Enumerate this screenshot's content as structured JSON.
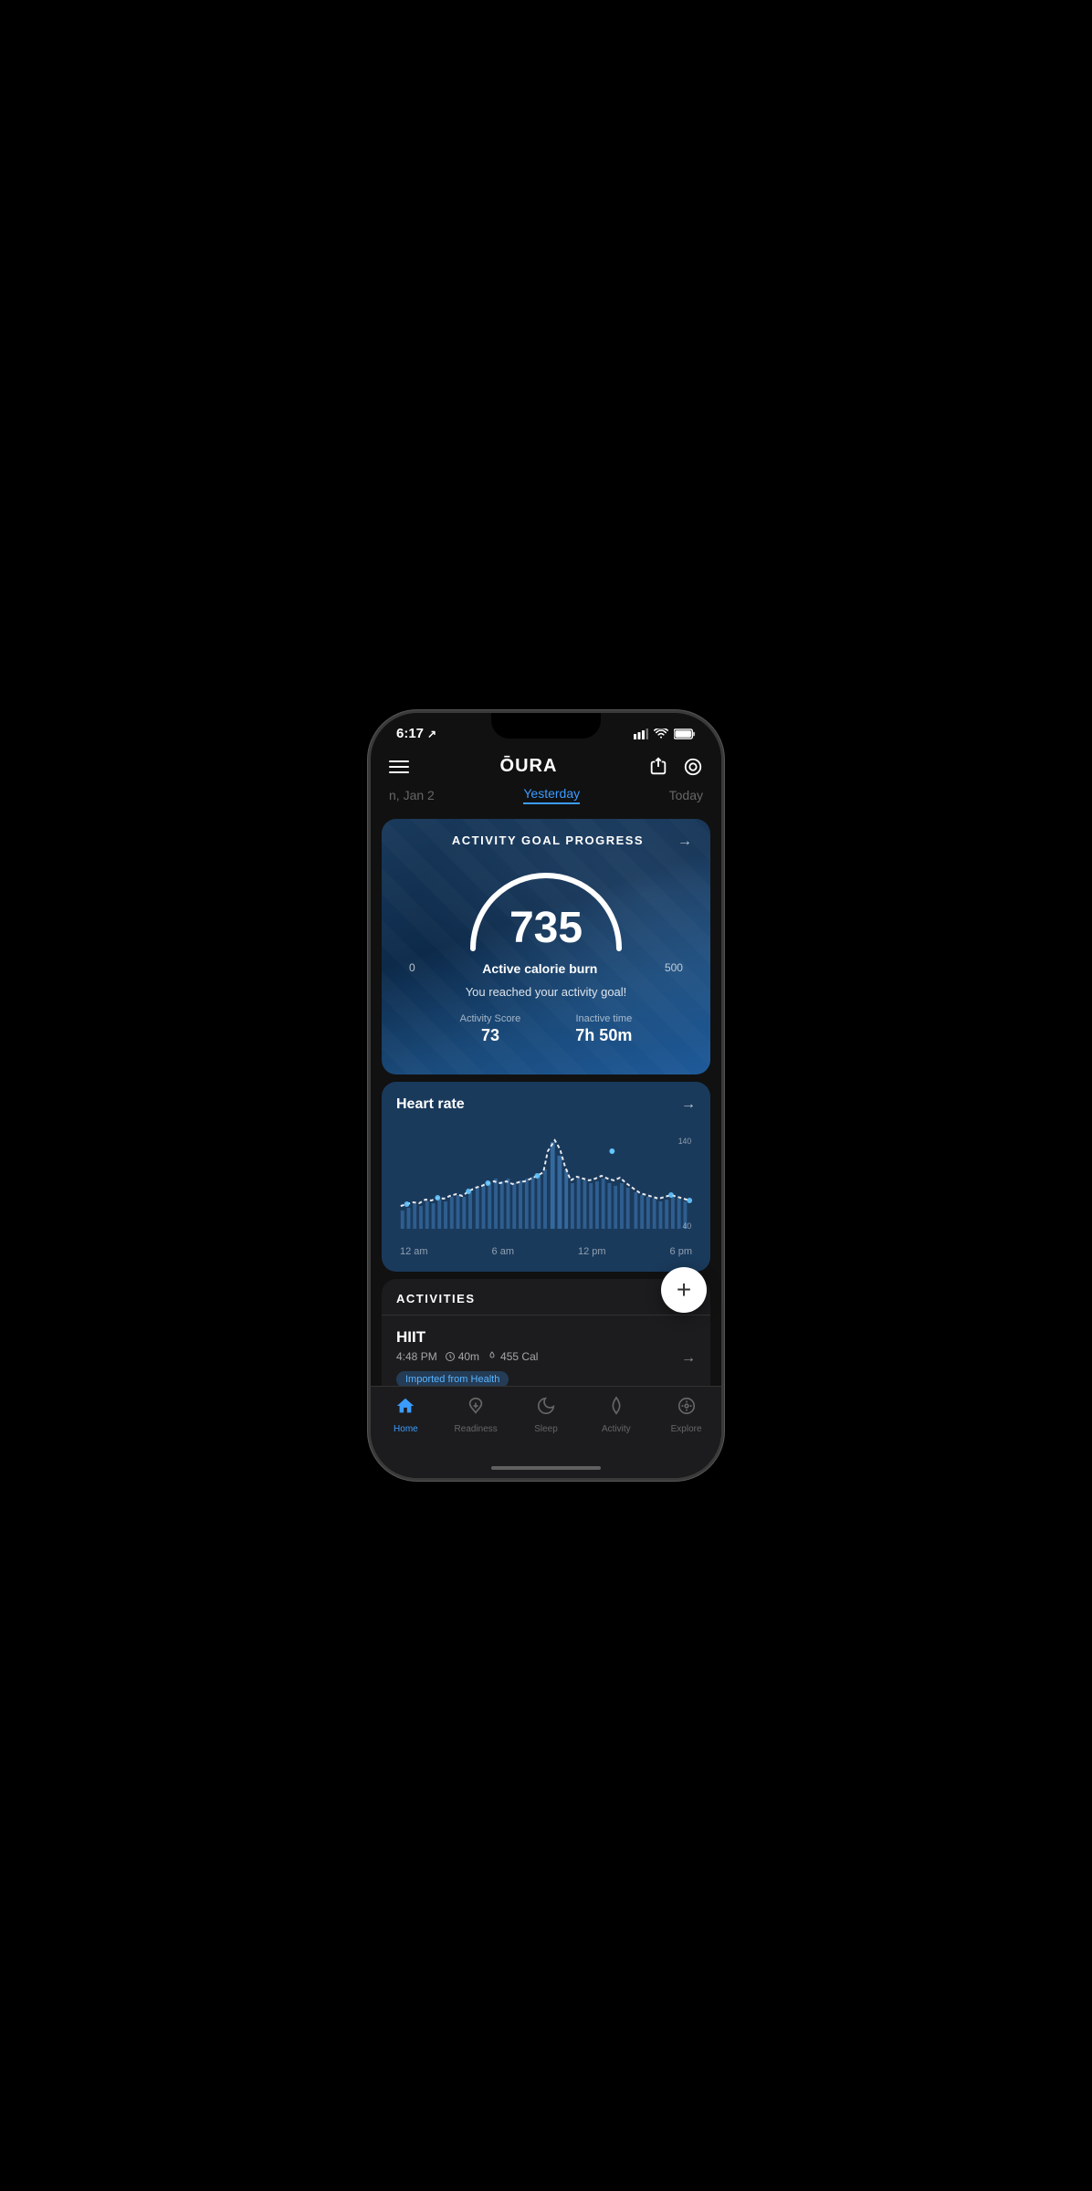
{
  "status": {
    "time": "6:17",
    "location_icon": "↗",
    "signal_bars": "|||",
    "wifi": "wifi",
    "battery": "battery"
  },
  "header": {
    "menu_label": "menu",
    "title": "ŌURA",
    "share_icon": "share",
    "ring_icon": "ring"
  },
  "date_tabs": {
    "prev": "n, Jan 2",
    "current": "Yesterday",
    "next": "Today"
  },
  "activity_card": {
    "title": "ACTIVITY GOAL PROGRESS",
    "arrow": "→",
    "gauge_value": "735",
    "gauge_min": "0",
    "gauge_max": "500",
    "gauge_label": "Active calorie burn",
    "goal_message": "You reached your activity goal!",
    "activity_score_label": "Activity Score",
    "activity_score_value": "73",
    "inactive_time_label": "Inactive time",
    "inactive_time_value": "7h 50m"
  },
  "heart_rate_card": {
    "title": "Heart rate",
    "arrow": "→",
    "y_max": "140",
    "y_min": "40",
    "x_labels": [
      "12 am",
      "6 am",
      "12 pm",
      "6 pm"
    ]
  },
  "activities_section": {
    "title": "ACTIVITIES",
    "items": [
      {
        "name": "HIIT",
        "time": "4:48 PM",
        "duration": "40m",
        "calories": "455 Cal",
        "badge": "Imported from Health",
        "arrow": "→"
      }
    ]
  },
  "bottom_nav": {
    "items": [
      {
        "label": "Home",
        "icon": "home",
        "active": true
      },
      {
        "label": "Readiness",
        "icon": "readiness",
        "active": false
      },
      {
        "label": "Sleep",
        "icon": "sleep",
        "active": false
      },
      {
        "label": "Activity",
        "icon": "activity",
        "active": false
      },
      {
        "label": "Explore",
        "icon": "explore",
        "active": false
      }
    ]
  }
}
